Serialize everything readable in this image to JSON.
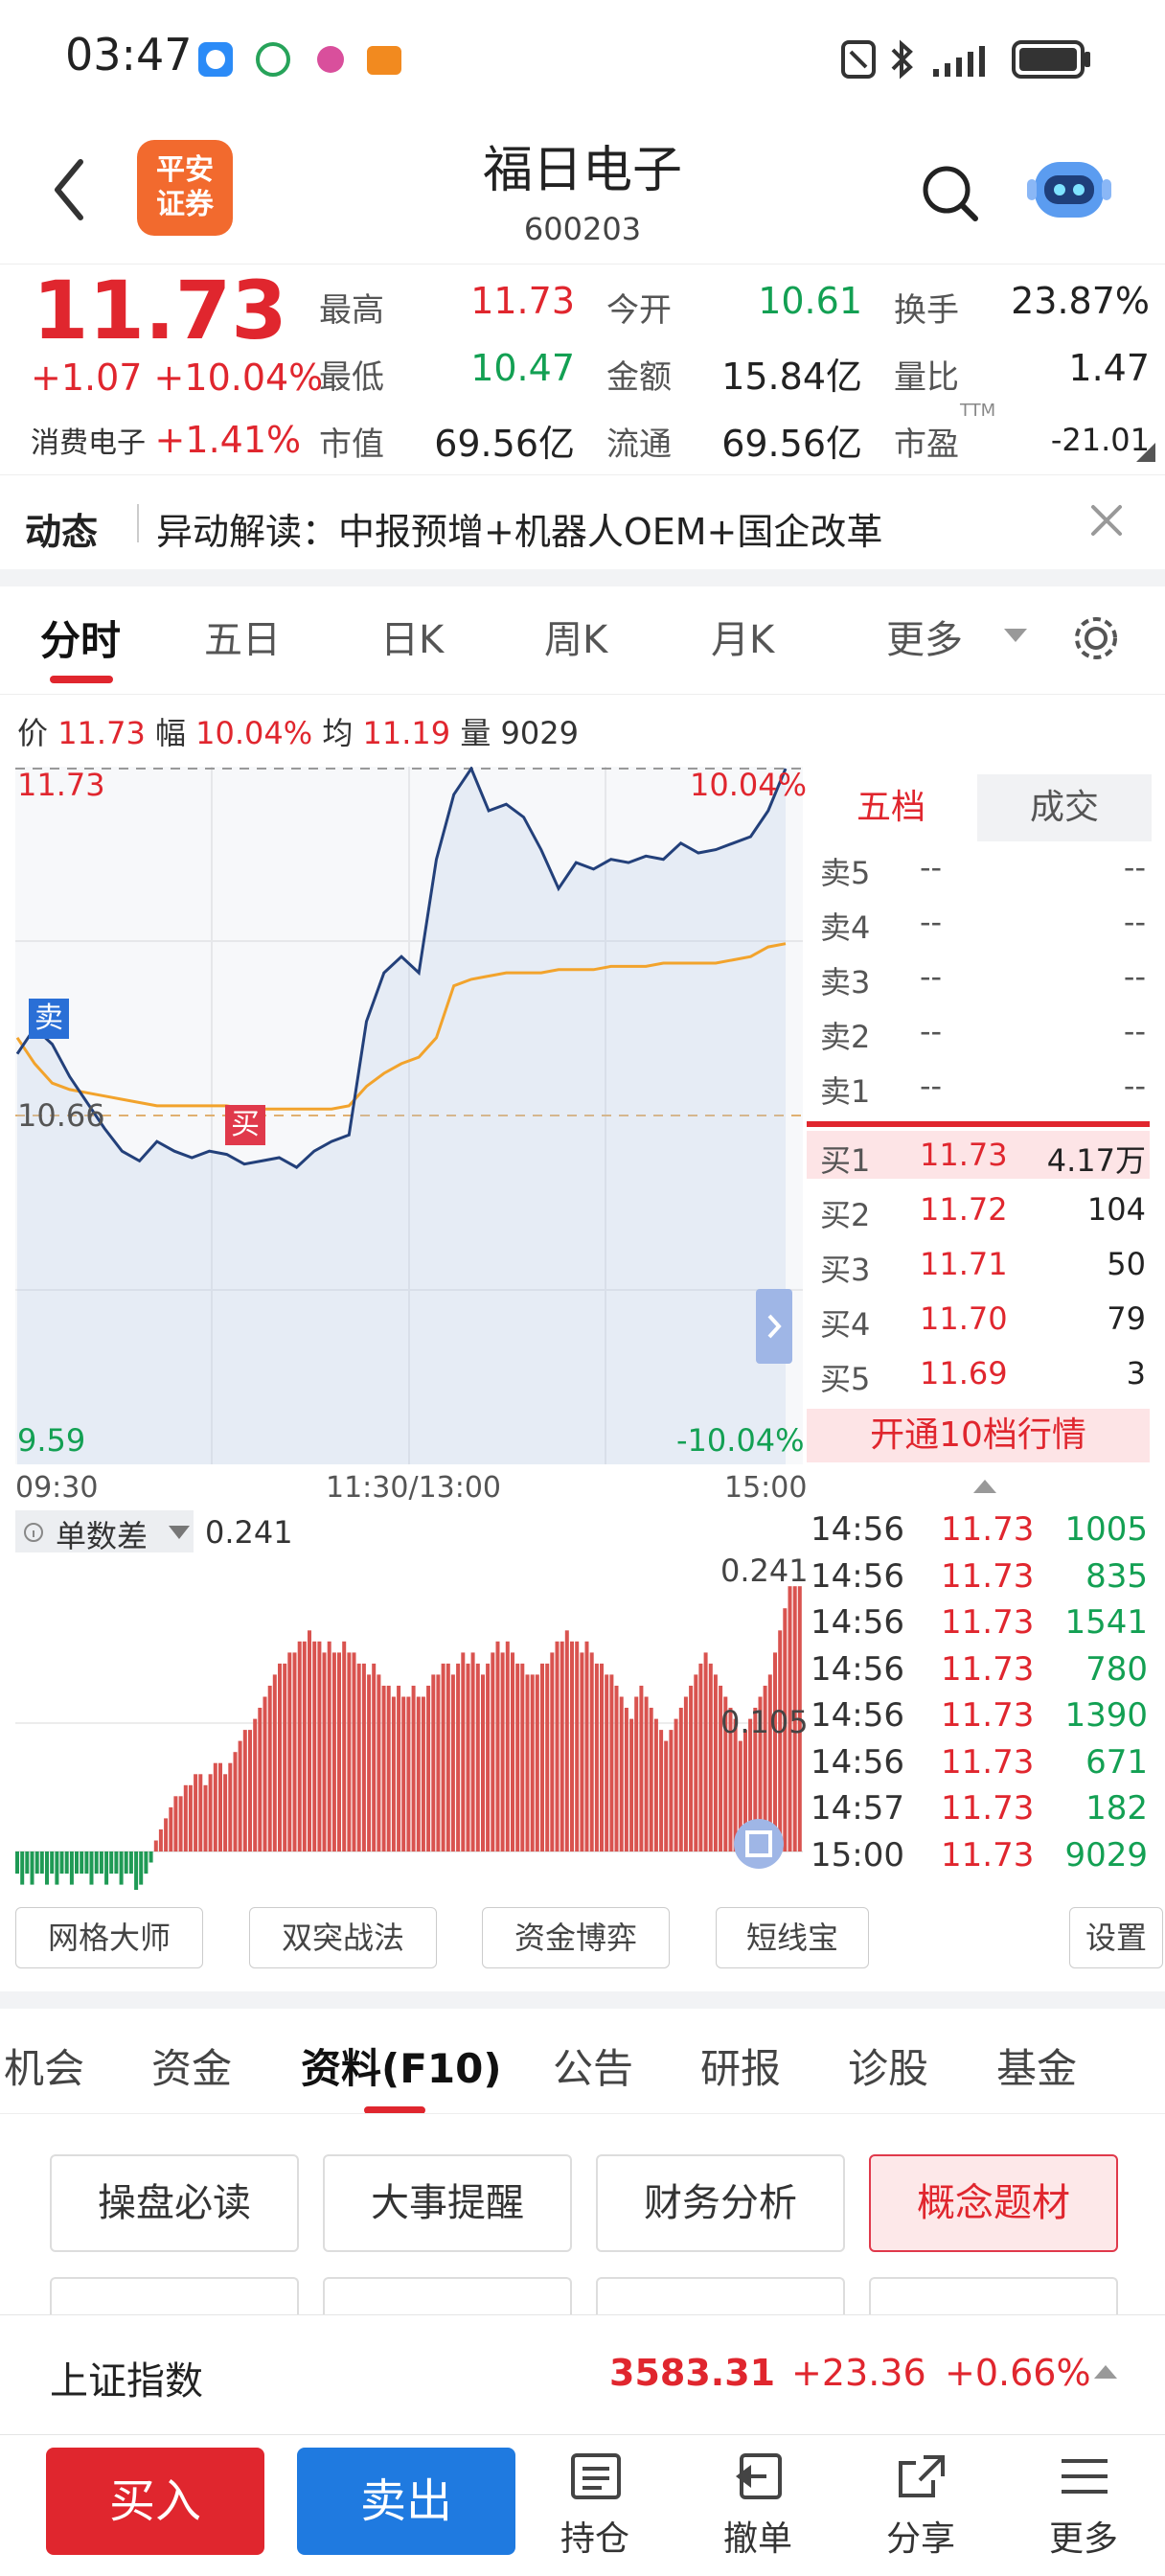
{
  "status": {
    "time": "03:47"
  },
  "header": {
    "logo_line1": "平安",
    "logo_line2": "证券",
    "title": "福日电子",
    "code": "600203"
  },
  "quote": {
    "price": "11.73",
    "change": "+1.07",
    "change_pct": "+10.04%",
    "sector_name": "消费电子",
    "sector_pct": "+1.41%",
    "fields": [
      {
        "label": "最高",
        "value": "11.73"
      },
      {
        "label": "今开",
        "value": "10.61"
      },
      {
        "label": "换手",
        "value": "23.87%"
      },
      {
        "label": "最低",
        "value": "10.47"
      },
      {
        "label": "金额",
        "value": "15.84亿"
      },
      {
        "label": "量比",
        "value": "1.47"
      },
      {
        "label": "市值",
        "value": "69.56亿"
      },
      {
        "label": "流通",
        "value": "69.56亿"
      },
      {
        "label": "市盈",
        "value": "-21.01",
        "superscript": "TTM"
      }
    ]
  },
  "news": {
    "label": "动态",
    "text": "异动解读：中报预增+机器人OEM+国企改革"
  },
  "chart_tabs": [
    "分时",
    "五日",
    "日K",
    "周K",
    "月K",
    "更多"
  ],
  "chart_info": {
    "price_label": "价",
    "price": "11.73",
    "amp_label": "幅",
    "amp": "10.04%",
    "avg_label": "均",
    "avg": "11.19",
    "vol_label": "量",
    "vol": "9029"
  },
  "chart_data": {
    "type": "line",
    "y_top": "11.73",
    "y_mid": "10.66",
    "y_bottom": "9.59",
    "pct_top": "10.04%",
    "pct_bottom": "-10.04%",
    "x_labels": [
      "09:30",
      "11:30/13:00",
      "15:00"
    ],
    "markers": {
      "sell": "卖",
      "buy": "买"
    },
    "ylim": [
      9.59,
      11.73
    ],
    "series": [
      {
        "name": "价",
        "values": [
          10.85,
          10.93,
          10.88,
          10.78,
          10.7,
          10.62,
          10.55,
          10.52,
          10.58,
          10.55,
          10.53,
          10.55,
          10.54,
          10.51,
          10.52,
          10.53,
          10.5,
          10.55,
          10.58,
          10.6,
          10.95,
          11.1,
          11.15,
          11.1,
          11.45,
          11.65,
          11.73,
          11.6,
          11.62,
          11.58,
          11.48,
          11.36,
          11.44,
          11.42,
          11.45,
          11.44,
          11.46,
          11.45,
          11.5,
          11.47,
          11.48,
          11.5,
          11.52,
          11.6,
          11.73
        ]
      },
      {
        "name": "均",
        "values": [
          10.9,
          10.82,
          10.76,
          10.74,
          10.73,
          10.72,
          10.71,
          10.7,
          10.69,
          10.69,
          10.69,
          10.69,
          10.69,
          10.68,
          10.68,
          10.68,
          10.68,
          10.68,
          10.68,
          10.69,
          10.75,
          10.79,
          10.82,
          10.84,
          10.9,
          11.06,
          11.08,
          11.09,
          11.1,
          11.1,
          11.1,
          11.11,
          11.11,
          11.11,
          11.12,
          11.12,
          11.12,
          11.13,
          11.13,
          11.13,
          11.13,
          11.14,
          11.15,
          11.18,
          11.19
        ]
      }
    ]
  },
  "order_book": {
    "tab_five": "五档",
    "tab_trades": "成交",
    "sells": [
      {
        "label": "卖5",
        "price": "--",
        "vol": "--"
      },
      {
        "label": "卖4",
        "price": "--",
        "vol": "--"
      },
      {
        "label": "卖3",
        "price": "--",
        "vol": "--"
      },
      {
        "label": "卖2",
        "price": "--",
        "vol": "--"
      },
      {
        "label": "卖1",
        "price": "--",
        "vol": "--"
      }
    ],
    "buys": [
      {
        "label": "买1",
        "price": "11.73",
        "vol": "4.17万"
      },
      {
        "label": "买2",
        "price": "11.72",
        "vol": "104"
      },
      {
        "label": "买3",
        "price": "11.71",
        "vol": "50"
      },
      {
        "label": "买4",
        "price": "11.70",
        "vol": "79"
      },
      {
        "label": "买5",
        "price": "11.69",
        "vol": "3"
      }
    ],
    "upgrade_text": "开通10档行情"
  },
  "indicator": {
    "name": "单数差",
    "value": "0.241",
    "y_top": "0.241",
    "y_mid": "0.105"
  },
  "indicator_bars": [
    -0.02,
    -0.03,
    -0.02,
    -0.03,
    -0.02,
    -0.02,
    -0.03,
    -0.02,
    -0.03,
    -0.02,
    -0.02,
    -0.03,
    -0.02,
    -0.02,
    -0.02,
    -0.03,
    -0.02,
    -0.02,
    -0.03,
    -0.02,
    -0.02,
    -0.03,
    -0.02,
    -0.02,
    -0.04,
    -0.03,
    -0.02,
    -0.01,
    0.01,
    0.02,
    0.03,
    0.04,
    0.05,
    0.05,
    0.06,
    0.06,
    0.07,
    0.07,
    0.06,
    0.07,
    0.08,
    0.08,
    0.07,
    0.08,
    0.09,
    0.1,
    0.11,
    0.11,
    0.12,
    0.13,
    0.14,
    0.15,
    0.16,
    0.17,
    0.17,
    0.18,
    0.18,
    0.19,
    0.19,
    0.2,
    0.19,
    0.19,
    0.18,
    0.19,
    0.18,
    0.18,
    0.19,
    0.18,
    0.18,
    0.17,
    0.17,
    0.16,
    0.17,
    0.16,
    0.15,
    0.15,
    0.14,
    0.15,
    0.14,
    0.14,
    0.15,
    0.14,
    0.14,
    0.15,
    0.16,
    0.16,
    0.17,
    0.17,
    0.16,
    0.17,
    0.18,
    0.17,
    0.18,
    0.17,
    0.16,
    0.17,
    0.18,
    0.19,
    0.18,
    0.19,
    0.18,
    0.17,
    0.17,
    0.16,
    0.16,
    0.16,
    0.17,
    0.17,
    0.18,
    0.19,
    0.19,
    0.2,
    0.19,
    0.19,
    0.18,
    0.19,
    0.18,
    0.17,
    0.17,
    0.16,
    0.16,
    0.15,
    0.14,
    0.13,
    0.12,
    0.14,
    0.15,
    0.14,
    0.13,
    0.12,
    0.11,
    0.1,
    0.11,
    0.12,
    0.13,
    0.14,
    0.15,
    0.16,
    0.17,
    0.18,
    0.17,
    0.16,
    0.15,
    0.14,
    0.13,
    0.12,
    0.1,
    0.11,
    0.12,
    0.13,
    0.14,
    0.15,
    0.16,
    0.18,
    0.2,
    0.22,
    0.24,
    0.24,
    0.24
  ],
  "trades": [
    {
      "time": "14:56",
      "price": "11.73",
      "vol": "1005"
    },
    {
      "time": "14:56",
      "price": "11.73",
      "vol": "835"
    },
    {
      "time": "14:56",
      "price": "11.73",
      "vol": "1541"
    },
    {
      "time": "14:56",
      "price": "11.73",
      "vol": "780"
    },
    {
      "time": "14:56",
      "price": "11.73",
      "vol": "1390"
    },
    {
      "time": "14:56",
      "price": "11.73",
      "vol": "671"
    },
    {
      "time": "14:57",
      "price": "11.73",
      "vol": "182"
    },
    {
      "time": "15:00",
      "price": "11.73",
      "vol": "9029"
    }
  ],
  "tools": [
    "网格大师",
    "双突战法",
    "资金博弈",
    "短线宝",
    "设置"
  ],
  "section_tabs": [
    "机会",
    "资金",
    "资料(F10)",
    "公告",
    "研报",
    "诊股",
    "基金"
  ],
  "f10_buttons": [
    "操盘必读",
    "大事提醒",
    "财务分析",
    "概念题材"
  ],
  "index_bar": {
    "name": "上证指数",
    "value": "3583.31",
    "change": "+23.36",
    "pct": "+0.66%"
  },
  "bottom_nav": {
    "buy": "买入",
    "sell": "卖出",
    "items": [
      "持仓",
      "撤单",
      "分享",
      "更多"
    ]
  }
}
